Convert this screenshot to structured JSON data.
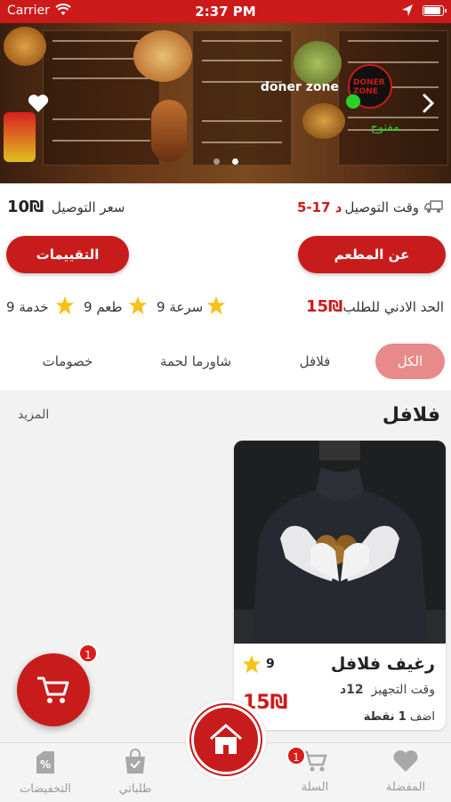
{
  "status_bar": {
    "carrier": "Carrier",
    "time": "2:37 PM"
  },
  "restaurant": {
    "name": "doner zone",
    "open_label": "مفتوح",
    "logo_text": "DONER ZONE"
  },
  "info": {
    "delivery_time_label": "وقت التوصيل",
    "delivery_time_value": "5-17 د",
    "delivery_fee_label": "سعر التوصيل",
    "delivery_fee_value": "10₪",
    "about_button": "عن المطعم",
    "reviews_button": "التقييمات",
    "min_order_label": "الحد الادني للطلب",
    "min_order_value": "15₪",
    "ratings": [
      {
        "label": "سرعة",
        "value": "9"
      },
      {
        "label": "طعم",
        "value": "9"
      },
      {
        "label": "خدمة",
        "value": "9"
      }
    ]
  },
  "tabs": [
    {
      "label": "الكل",
      "active": true
    },
    {
      "label": "فلافل",
      "active": false
    },
    {
      "label": "شاورما لحمة",
      "active": false
    },
    {
      "label": "خصومات",
      "active": false
    }
  ],
  "section": {
    "title": "فلافل",
    "more": "المزيد"
  },
  "product": {
    "name": "رغيف فلافل",
    "rating": "9",
    "prep_time_label": "وقت التجهيز",
    "prep_time_value": "12د",
    "price": "15₪",
    "points_prefix": "اضف",
    "points_value": "1",
    "points_suffix": "نقطة"
  },
  "fab_cart_badge": "1",
  "bottom_nav": {
    "favorites": "المفضلة",
    "cart": "السلة",
    "cart_badge": "1",
    "orders": "طلباتي",
    "discounts": "التخفيضات"
  },
  "colors": {
    "brand": "#c81c1c",
    "tab_active": "#e98a8a",
    "open_status": "#2bd12b"
  }
}
